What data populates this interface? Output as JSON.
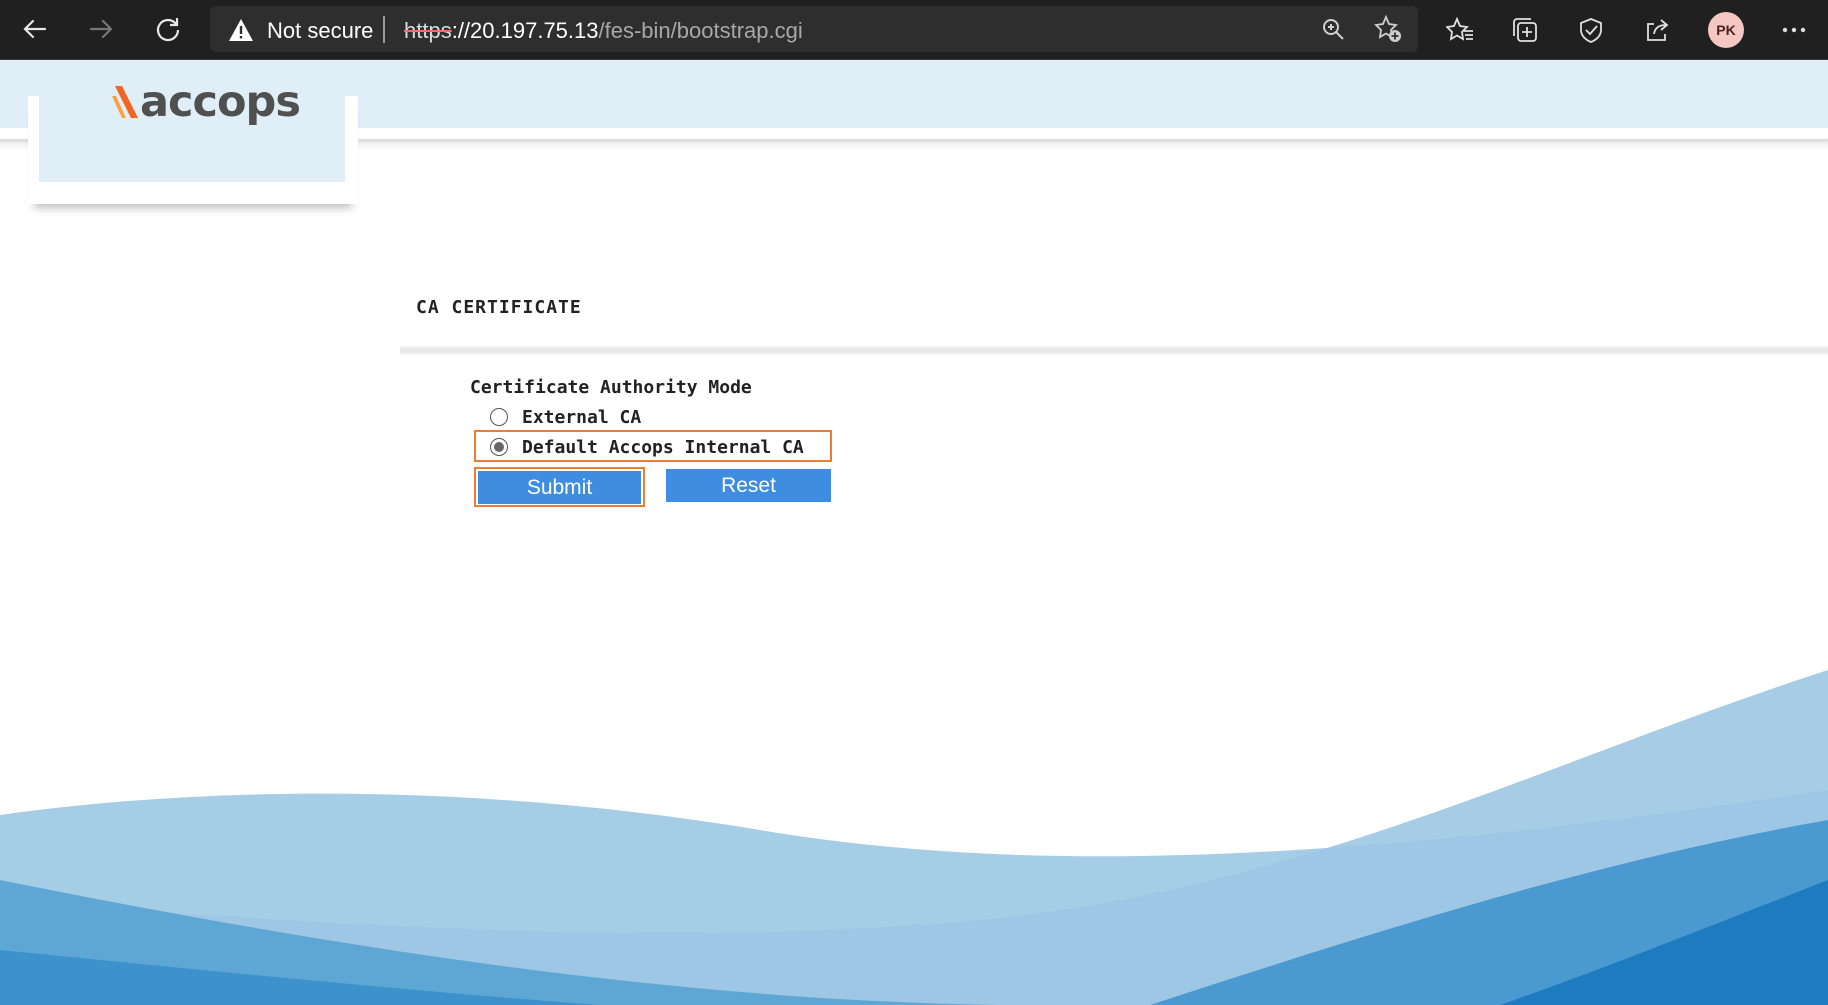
{
  "browser": {
    "security_label": "Not secure",
    "url": {
      "scheme": "https",
      "rest_host": "://20.197.75.13",
      "path": "/fes-bin/bootstrap.cgi"
    },
    "profile_initials": "PK",
    "icons": [
      "back-icon",
      "forward-icon",
      "refresh-icon",
      "warning-icon",
      "zoom-icon",
      "add-favorite-icon",
      "favorites-icon",
      "collections-icon",
      "extensions-icon",
      "share-icon",
      "more-icon"
    ]
  },
  "page": {
    "logo_text": "accops",
    "section_title": "CA CERTIFICATE",
    "form": {
      "label": "Certificate Authority Mode",
      "options": [
        {
          "label": "External CA",
          "selected": false
        },
        {
          "label": "Default Accops Internal CA",
          "selected": true
        }
      ],
      "submit_label": "Submit",
      "reset_label": "Reset"
    }
  },
  "colors": {
    "accent_button": "#3e8de0",
    "highlight": "#ed7d31",
    "header_band": "#e0eef8",
    "logo_orange": "#f26522"
  }
}
